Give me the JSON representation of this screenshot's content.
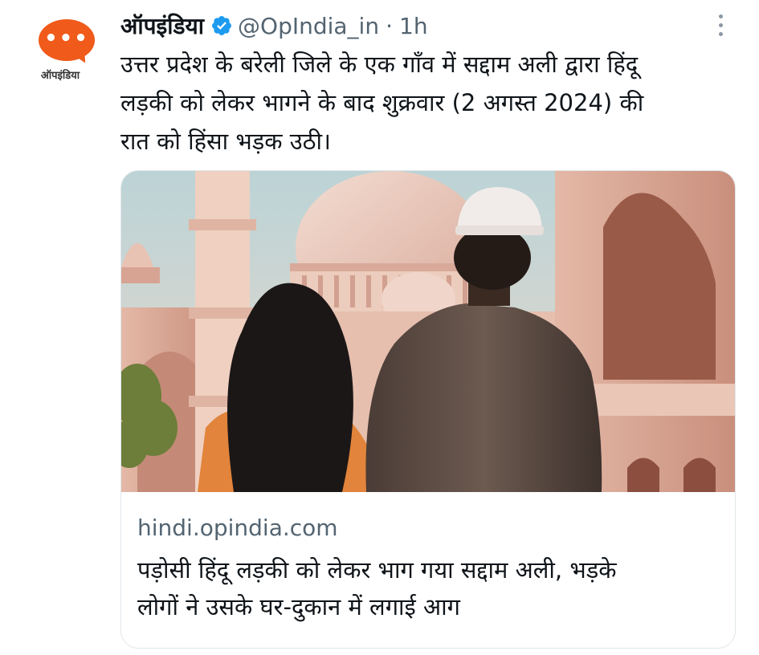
{
  "account": {
    "avatar_label": "ऑपइंडिया",
    "display_name": "ऑपइंडिया",
    "handle": "@OpIndia_in",
    "separator": "·",
    "time": "1h",
    "verified_color": "#1d9bf0",
    "brand_color": "#f05a1a"
  },
  "tweet": {
    "lines": [
      "उत्तर प्रदेश के बरेली जिले के एक गाँव में सद्दाम अली द्वारा हिंदू",
      "लड़की को लेकर भागने के बाद शुक्रवार (2 अगस्त 2024) की",
      "रात को हिंसा भड़क उठी।"
    ]
  },
  "card": {
    "image_icon": "mosque-couple-illustration",
    "domain": "hindi.opindia.com",
    "title_lines": [
      "पड़ोसी हिंदू लड़की को लेकर भाग गया सद्दाम अली, भड़के",
      "लोगों ने उसके घर-दुकान में लगाई आग"
    ]
  },
  "icons": {
    "more": "more-vertical-icon",
    "verified": "verified-badge-icon"
  }
}
